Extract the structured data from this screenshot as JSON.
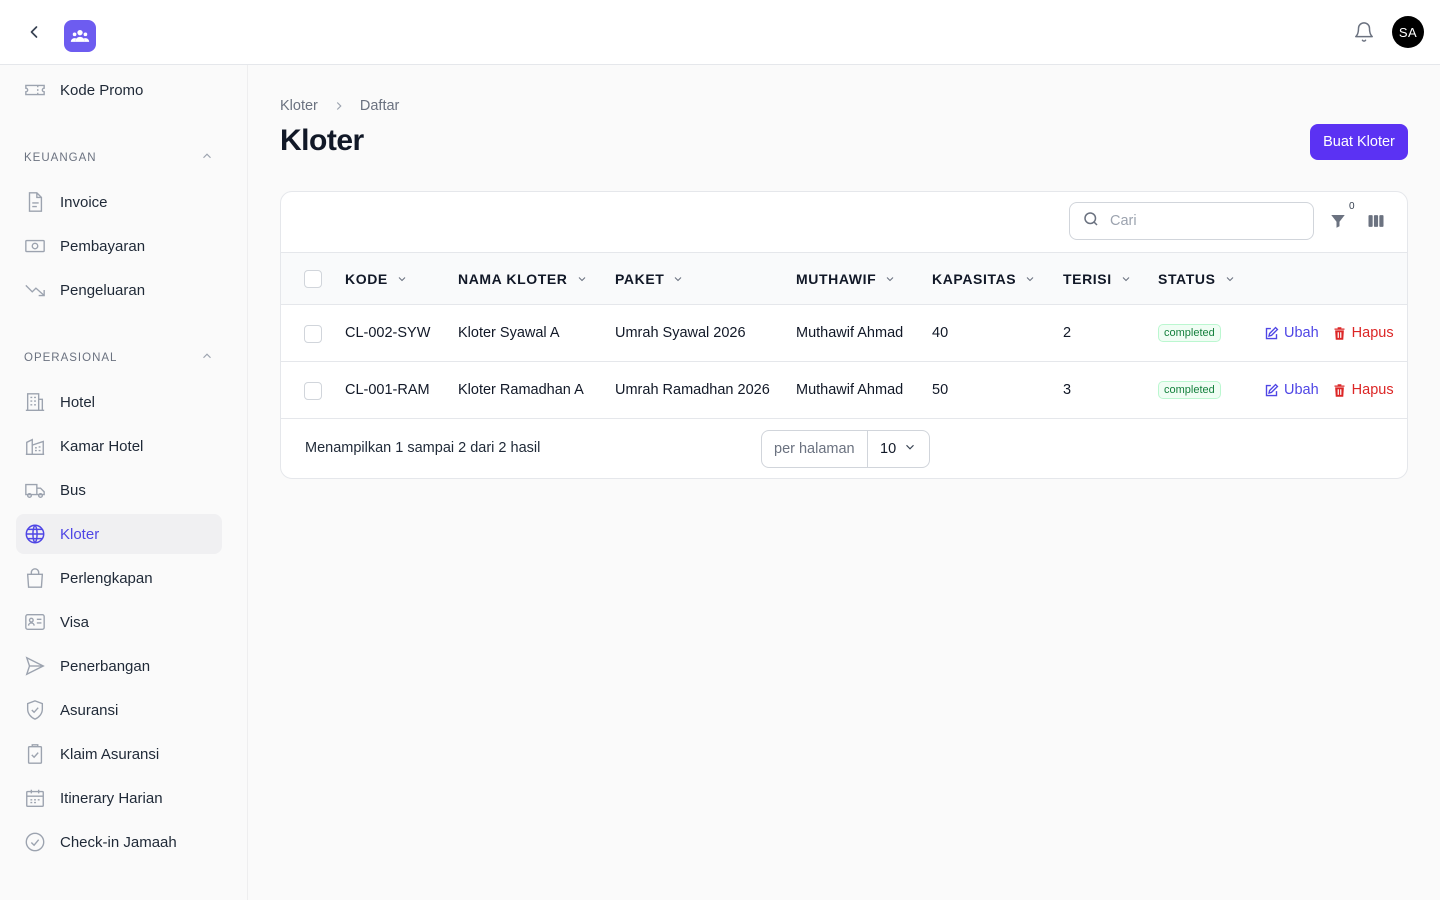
{
  "header": {
    "avatar_initials": "SA"
  },
  "sidebar": {
    "top_item": {
      "label": "Kode Promo",
      "icon": "ticket-icon"
    },
    "groups": [
      {
        "label": "KEUANGAN",
        "items": [
          {
            "label": "Invoice",
            "icon": "document-icon"
          },
          {
            "label": "Pembayaran",
            "icon": "cash-icon"
          },
          {
            "label": "Pengeluaran",
            "icon": "trending-down-icon"
          }
        ]
      },
      {
        "label": "OPERASIONAL",
        "items": [
          {
            "label": "Hotel",
            "icon": "building-icon"
          },
          {
            "label": "Kamar Hotel",
            "icon": "building-office-icon"
          },
          {
            "label": "Bus",
            "icon": "truck-icon"
          },
          {
            "label": "Kloter",
            "icon": "globe-icon",
            "active": true
          },
          {
            "label": "Perlengkapan",
            "icon": "shopping-bag-icon"
          },
          {
            "label": "Visa",
            "icon": "identification-icon"
          },
          {
            "label": "Penerbangan",
            "icon": "paper-airplane-icon"
          },
          {
            "label": "Asuransi",
            "icon": "shield-check-icon"
          },
          {
            "label": "Klaim Asuransi",
            "icon": "clipboard-check-icon"
          },
          {
            "label": "Itinerary Harian",
            "icon": "calendar-icon"
          },
          {
            "label": "Check-in Jamaah",
            "icon": "check-circle-icon"
          }
        ]
      }
    ]
  },
  "breadcrumb": [
    "Kloter",
    "Daftar"
  ],
  "page": {
    "title": "Kloter",
    "create_button": "Buat Kloter"
  },
  "table": {
    "search_placeholder": "Cari",
    "filter_count": "0",
    "columns": [
      "KODE",
      "NAMA KLOTER",
      "PAKET",
      "MUTHAWIF",
      "KAPASITAS",
      "TERISI",
      "STATUS"
    ],
    "rows": [
      {
        "kode": "CL-002-SYW",
        "nama": "Kloter Syawal A",
        "paket": "Umrah Syawal 2026",
        "muthawif": "Muthawif Ahmad",
        "kapasitas": "40",
        "terisi": "2",
        "status": "completed"
      },
      {
        "kode": "CL-001-RAM",
        "nama": "Kloter Ramadhan A",
        "paket": "Umrah Ramadhan 2026",
        "muthawif": "Muthawif Ahmad",
        "kapasitas": "50",
        "terisi": "3",
        "status": "completed"
      }
    ],
    "edit_label": "Ubah",
    "delete_label": "Hapus",
    "summary": "Menampilkan 1 sampai 2 dari 2 hasil",
    "per_page_label": "per halaman",
    "per_page_value": "10"
  },
  "colors": {
    "accent": "#5b32f3",
    "active_text": "#4f46e5",
    "danger": "#dc2626",
    "success": "#15803d"
  }
}
